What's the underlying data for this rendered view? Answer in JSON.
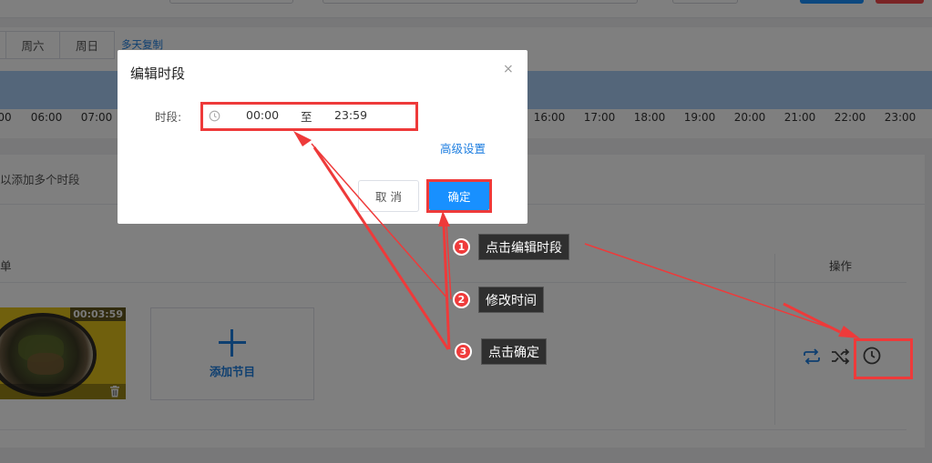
{
  "week_tabs": [
    "周六",
    "周日"
  ],
  "multi_copy_link": "多天复制",
  "timeline_ticks": [
    "00",
    "06:00",
    "07:00",
    "16:00",
    "17:00",
    "18:00",
    "19:00",
    "20:00",
    "21:00",
    "22:00",
    "23:00"
  ],
  "list": {
    "hint": "以添加多个时段",
    "column_left": "单",
    "column_ops": "操作",
    "item_duration": "00:03:59",
    "add_program_label": "添加节目"
  },
  "dialog": {
    "title": "编辑时段",
    "close": "×",
    "range_label": "时段:",
    "start_time": "00:00",
    "separator": "至",
    "end_time": "23:59",
    "advanced_link": "高级设置",
    "cancel_label": "取 消",
    "ok_label": "确定"
  },
  "annotations": [
    {
      "number": "1",
      "text": "点击编辑时段"
    },
    {
      "number": "2",
      "text": "修改时间"
    },
    {
      "number": "3",
      "text": "点击确定"
    }
  ],
  "colors": {
    "primary": "#1890ff",
    "link": "#1d7ee0",
    "annotation_red": "#ee3a3a",
    "callout_bg": "#2f2f2f"
  }
}
